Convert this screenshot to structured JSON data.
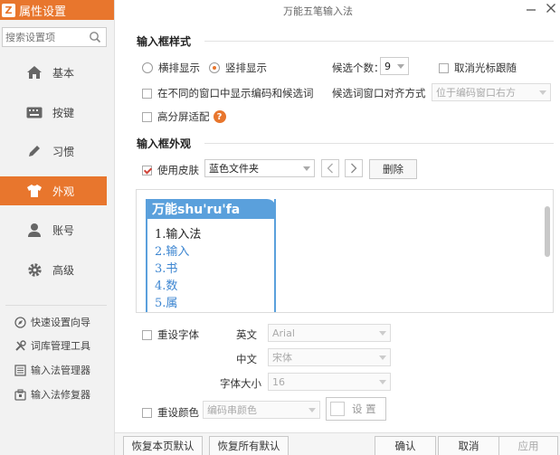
{
  "sidebar": {
    "title": "属性设置",
    "search_placeholder": "搜索设置项",
    "nav": [
      {
        "label": "基本",
        "icon": "home-icon"
      },
      {
        "label": "按键",
        "icon": "keyboard-icon"
      },
      {
        "label": "习惯",
        "icon": "pencil-icon"
      },
      {
        "label": "外观",
        "icon": "tshirt-icon"
      },
      {
        "label": "账号",
        "icon": "user-icon"
      },
      {
        "label": "高级",
        "icon": "gear-icon"
      }
    ],
    "active_nav": "外观",
    "tools": [
      {
        "label": "快速设置向导",
        "icon": "compass-icon"
      },
      {
        "label": "词库管理工具",
        "icon": "tools-icon"
      },
      {
        "label": "输入法管理器",
        "icon": "list-icon"
      },
      {
        "label": "输入法修复器",
        "icon": "repair-icon"
      }
    ]
  },
  "window": {
    "title": "万能五笔输入法"
  },
  "input_box_style": {
    "section_title": "输入框样式",
    "horizontal_label": "横排显示",
    "vertical_label": "竖排显示",
    "selected_layout": "竖排显示",
    "candidate_count_label": "候选个数：",
    "candidate_count_value": "9",
    "cancel_cursor_follow_label": "取消光标跟随",
    "cancel_cursor_follow_checked": false,
    "show_in_different_window_label": "在不同的窗口中显示编码和候选词",
    "show_in_different_window_checked": false,
    "alignment_label": "候选词窗口对齐方式",
    "alignment_value": "位于编码窗口右方",
    "hidpi_label": "高分屏适配",
    "hidpi_checked": false
  },
  "input_box_appearance": {
    "section_title": "输入框外观",
    "use_skin_label": "使用皮肤",
    "use_skin_checked": true,
    "skin_value": "蓝色文件夹",
    "delete_label": "删除"
  },
  "preview": {
    "header": "万能shu'ru'fa",
    "candidates": [
      "1.输入法",
      "2.输入",
      "3.书",
      "4.数",
      "5.属"
    ]
  },
  "font": {
    "reset_font_label": "重设字体",
    "reset_font_checked": false,
    "english_label": "英文",
    "english_value": "Arial",
    "chinese_label": "中文",
    "chinese_value": "宋体",
    "size_label": "字体大小",
    "size_value": "16"
  },
  "color": {
    "reset_color_label": "重设颜色",
    "reset_color_checked": false,
    "color_target_value": "编码串颜色",
    "setting_label": "设 置"
  },
  "footer": {
    "restore_page_label": "恢复本页默认",
    "restore_all_label": "恢复所有默认",
    "ok_label": "确认",
    "cancel_label": "取消",
    "apply_label": "应用"
  },
  "colors": {
    "accent": "#e8762d",
    "preview_blue": "#5aa0dc"
  }
}
